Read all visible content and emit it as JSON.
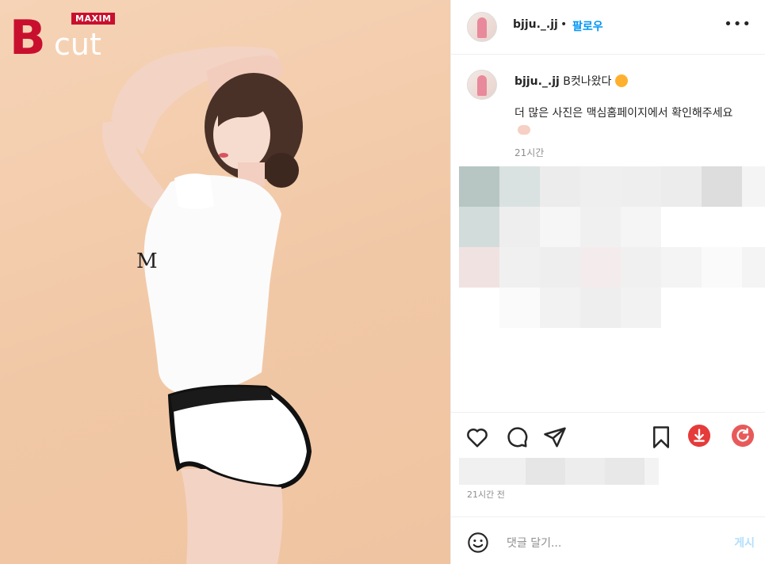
{
  "post": {
    "username": "bjju._.jj",
    "separator": "•",
    "follow_label": "팔로우",
    "more_label": "•••",
    "caption_username": "bjju._.jj",
    "caption_title": "B컷나왔다",
    "caption_body": "더 많은 사진은 맥심홈페이지에서 확인해주세요",
    "caption_time": "21시간",
    "post_time": "21시간 전"
  },
  "media": {
    "logo_letter": "B",
    "logo_word": "cut",
    "logo_badge": "MAXIM"
  },
  "actions": {
    "like": "heart-icon",
    "comment": "comment-icon",
    "share": "send-icon",
    "save": "bookmark-icon",
    "download": "download-icon",
    "refresh": "refresh-icon"
  },
  "comment": {
    "placeholder": "댓글 달기...",
    "post_label": "게시"
  },
  "colors": {
    "accent": "#0095f6",
    "brand_red": "#c8102e",
    "download_red": "#e53b3b"
  }
}
